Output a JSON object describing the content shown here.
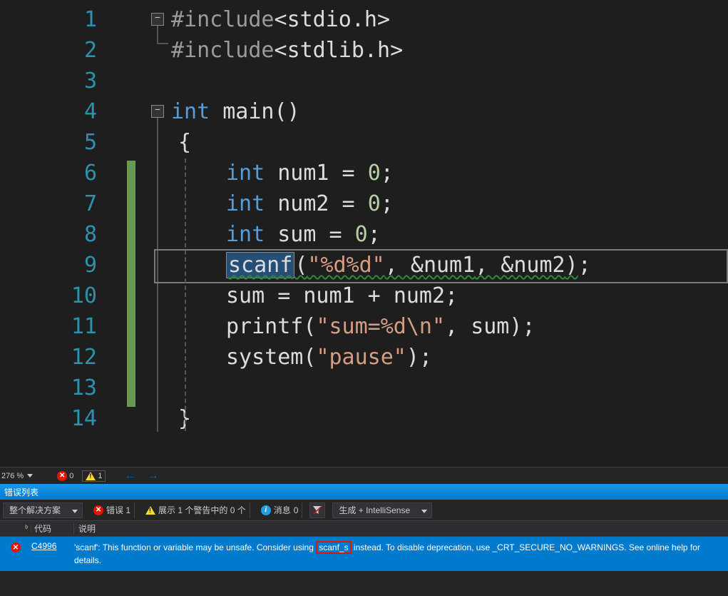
{
  "editor": {
    "lines": [
      "1",
      "2",
      "3",
      "4",
      "5",
      "6",
      "7",
      "8",
      "9",
      "10",
      "11",
      "12",
      "13",
      "14"
    ],
    "code": {
      "l1": {
        "pp": "#include",
        "lt": "<",
        "hdr": "stdio.h",
        "gt": ">"
      },
      "l2": {
        "pp": "#include",
        "lt": "<",
        "hdr": "stdlib.h",
        "gt": ">"
      },
      "l4": {
        "kw": "int",
        "fn": "main",
        "p": "()"
      },
      "l5": {
        "brace": "{"
      },
      "l6": {
        "kw": "int",
        "id": "num1",
        "eq": " = ",
        "num": "0",
        "semi": ";"
      },
      "l7": {
        "kw": "int",
        "id": "num2",
        "eq": " = ",
        "num": "0",
        "semi": ";"
      },
      "l8": {
        "kw": "int",
        "id": "sum",
        "eq": " = ",
        "num": "0",
        "semi": ";"
      },
      "l9": {
        "fn": "scanf",
        "lp": "(",
        "str": "\"%d%d\"",
        "c1": ", &",
        "a1": "num1",
        "c2": ", &",
        "a2": "num2",
        "rp": ")",
        "semi": ";"
      },
      "l10": {
        "lhs": "sum",
        "eq": " = ",
        "r1": "num1",
        "plus": " + ",
        "r2": "num2",
        "semi": ";"
      },
      "l11": {
        "fn": "printf",
        "lp": "(",
        "str": "\"sum=%d\\n\"",
        "c": ", ",
        "arg": "sum",
        "rp": ")",
        "semi": ";"
      },
      "l12": {
        "fn": "system",
        "lp": "(",
        "str": "\"pause\"",
        "rp": ")",
        "semi": ";"
      },
      "l14": {
        "brace": "}"
      }
    }
  },
  "status": {
    "zoom": "276 %",
    "errors": "0",
    "warnings": "1"
  },
  "panel": {
    "title": "错误列表",
    "scope": "整个解决方案",
    "err_chip": "错误 1",
    "warn_chip": "展示 1 个警告中的 0 个",
    "msg_chip_label": "消息",
    "msg_chip_count": "0",
    "source": "生成 + IntelliSense",
    "col_code": "代码",
    "col_desc": "说明"
  },
  "error": {
    "code": "C4996",
    "desc_before": "'scanf': This function or variable may be unsafe. Consider using ",
    "desc_highlight": "scanf_s",
    "desc_after": " instead. To disable deprecation, use _CRT_SECURE_NO_WARNINGS. See online help for details."
  }
}
